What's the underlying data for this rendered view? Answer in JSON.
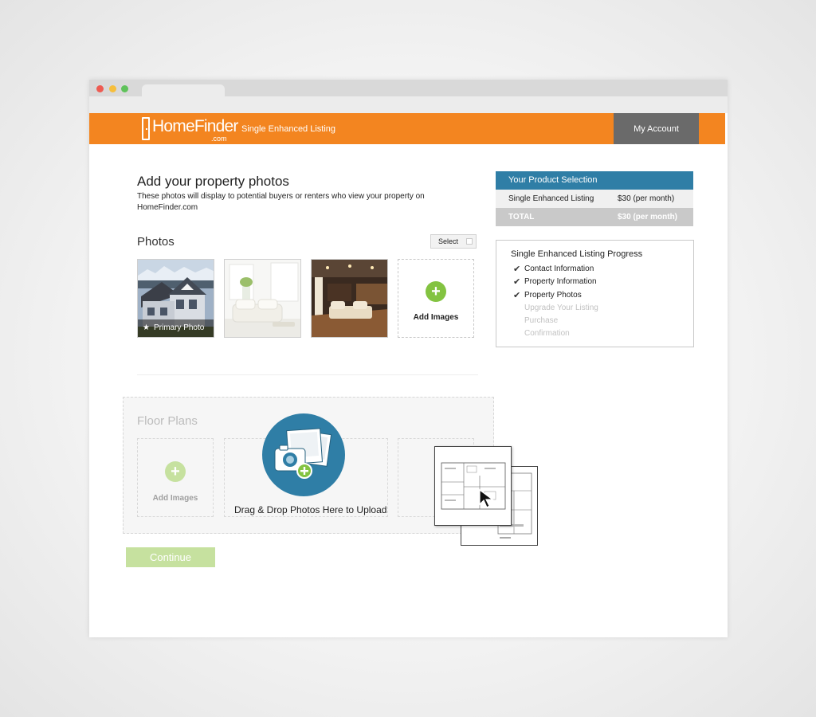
{
  "header": {
    "logo_text": "HomeFinder",
    "logo_suffix": ".com",
    "title": "Single Enhanced Listing",
    "account_label": "My Account"
  },
  "main": {
    "title": "Add your property photos",
    "description": "These photos will display to potential buyers or renters who view your property on HomeFinder.com"
  },
  "photos": {
    "section_title": "Photos",
    "select_label": "Select",
    "primary_caption": "Primary Photo",
    "add_label": "Add Images"
  },
  "floor_plans": {
    "section_title": "Floor Plans",
    "add_label": "Add Images",
    "drop_label": "Drag & Drop Photos Here to Upload"
  },
  "continue_label": "Continue",
  "summary": {
    "header": "Your Product Selection",
    "item_name": "Single Enhanced Listing",
    "item_price": "$30 (per month)",
    "total_label": "TOTAL",
    "total_price": "$30 (per month)"
  },
  "progress": {
    "title": "Single Enhanced Listing Progress",
    "steps": [
      {
        "label": "Contact Information",
        "done": true
      },
      {
        "label": "Property Information",
        "done": true
      },
      {
        "label": "Property Photos",
        "done": true
      },
      {
        "label": "Upgrade Your Listing",
        "done": false
      },
      {
        "label": "Purchase",
        "done": false
      },
      {
        "label": "Confirmation",
        "done": false
      }
    ]
  },
  "colors": {
    "brand_orange": "#f38520",
    "accent_blue": "#2f7ea6",
    "add_green": "#83c341",
    "account_gray": "#6a6a6a"
  },
  "icons": [
    "house-logo-icon",
    "star-icon",
    "plus-circle-icon",
    "camera-upload-icon",
    "checkmark-icon",
    "mouse-cursor-icon"
  ]
}
